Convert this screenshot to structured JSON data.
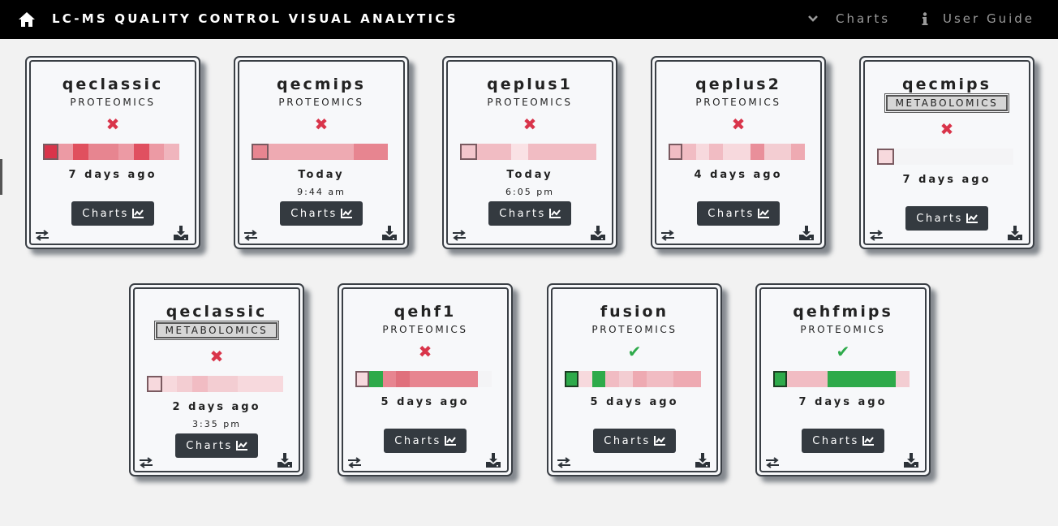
{
  "navbar": {
    "title": "LC-MS QUALITY CONTROL VISUAL ANALYTICS",
    "charts_label": "Charts",
    "guide_label": "User Guide",
    "icons": [
      "home-icon",
      "chevron-down-icon",
      "info-icon"
    ]
  },
  "colors": {
    "navbar_bg": "#000000",
    "fail": "#d9344a",
    "pass": "#2eaa4a",
    "button_bg": "#343a40"
  },
  "cards": [
    {
      "name": "qeclassic",
      "type": "PROTEOMICS",
      "status": "fail",
      "status_icon": "✖",
      "when": "7 days ago",
      "time": "",
      "button": "Charts",
      "boxed": false,
      "cells": [
        "#d9344a",
        "#ec9aa4",
        "#e0505e",
        "#e78590",
        "#e78590",
        "#ec9aa4",
        "#e05060",
        "#ec9aa4",
        "#f0b5bd"
      ]
    },
    {
      "name": "qecmips",
      "type": "PROTEOMICS",
      "status": "fail",
      "status_icon": "✖",
      "when": "Today",
      "time": "9:44 am",
      "button": "Charts",
      "boxed": false,
      "cells": [
        "#e78590",
        "#eeaab2",
        "#eeaab2",
        "#eeaab2",
        "#eeaab2",
        "#eeaab2",
        "#e78590",
        "#e78590"
      ]
    },
    {
      "name": "qeplus1",
      "type": "PROTEOMICS",
      "status": "fail",
      "status_icon": "✖",
      "when": "Today",
      "time": "6:05 pm",
      "button": "Charts",
      "boxed": false,
      "cells": [
        "#f3c6cc",
        "#f1bcc3",
        "#f1bcc3",
        "#fae2e5",
        "#f1bcc3",
        "#f1bcc3",
        "#f1bcc3",
        "#f1bcc3"
      ]
    },
    {
      "name": "qeplus2",
      "type": "PROTEOMICS",
      "status": "fail",
      "status_icon": "✖",
      "when": "4 days ago",
      "time": "",
      "button": "Charts",
      "boxed": false,
      "cells": [
        "#f1bcc3",
        "#f1bcc3",
        "#f7d9dd",
        "#f1bcc3",
        "#f7d9dd",
        "#f7d9dd",
        "#e98f9a",
        "#f3cdd2",
        "#f3cdd2",
        "#eeaab2"
      ]
    },
    {
      "name": "qecmips",
      "type": "METABOLOMICS",
      "status": "fail",
      "status_icon": "✖",
      "when": "7 days ago",
      "time": "",
      "button": "Charts",
      "boxed": true,
      "cells": [
        "#f7d9dd",
        "#f4f4f6",
        "#f4f4f6",
        "#f4f4f6",
        "#f4f4f6",
        "#f4f4f6",
        "#f4f4f6",
        "#f4f4f6"
      ]
    },
    {
      "name": "qeclassic",
      "type": "METABOLOMICS",
      "status": "fail",
      "status_icon": "✖",
      "when": "2 days ago",
      "time": "3:35 pm",
      "button": "Charts",
      "boxed": true,
      "cells": [
        "#f7d9dd",
        "#f7d9dd",
        "#f3cdd2",
        "#f1bcc3",
        "#f3cdd2",
        "#f3cdd2",
        "#f7d9dd",
        "#f7d9dd",
        "#f7d9dd"
      ]
    },
    {
      "name": "qehf1",
      "type": "PROTEOMICS",
      "status": "fail",
      "status_icon": "✖",
      "when": "5 days ago",
      "time": "",
      "button": "Charts",
      "boxed": false,
      "cells": [
        "#f7d9dd",
        "#2eaa4a",
        "#e78590",
        "#e0707c",
        "#e78590",
        "#e78590",
        "#e78590",
        "#e78590",
        "#e78590",
        "#f4f4f6"
      ]
    },
    {
      "name": "fusion",
      "type": "PROTEOMICS",
      "status": "pass",
      "status_icon": "✔",
      "when": "5 days ago",
      "time": "",
      "button": "Charts",
      "boxed": false,
      "cells": [
        "#2eaa4a",
        "#f7d9dd",
        "#2eaa4a",
        "#f1bcc3",
        "#f3cdd2",
        "#eeaab2",
        "#f1bcc3",
        "#f1bcc3",
        "#eeaab2",
        "#eeaab2"
      ]
    },
    {
      "name": "qehfmips",
      "type": "PROTEOMICS",
      "status": "pass",
      "status_icon": "✔",
      "when": "7 days ago",
      "time": "",
      "button": "Charts",
      "boxed": false,
      "cells": [
        "#2eaa4a",
        "#f1bcc3",
        "#f1bcc3",
        "#f1bcc3",
        "#2eaa4a",
        "#2eaa4a",
        "#2eaa4a",
        "#2eaa4a",
        "#2eaa4a",
        "#f3cdd2"
      ]
    }
  ]
}
